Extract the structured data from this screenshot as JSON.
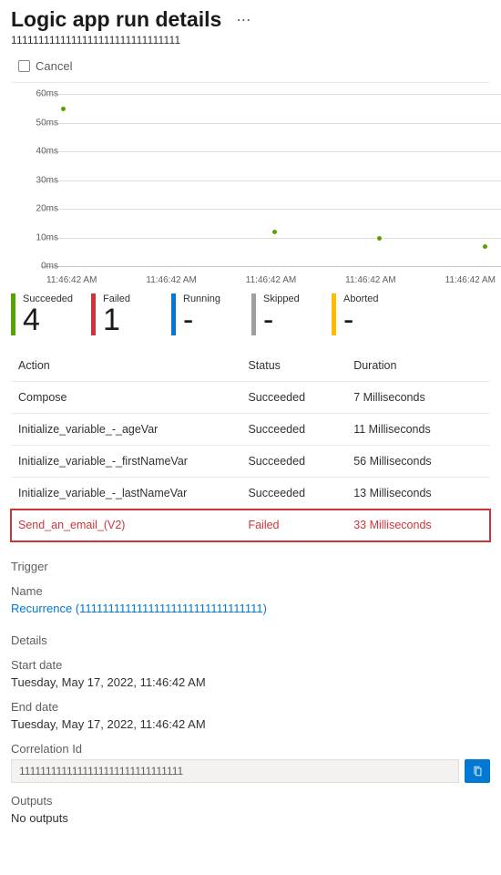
{
  "header": {
    "title": "Logic app run details",
    "run_id": "1111111111111111111111111111111",
    "cancel_label": "Cancel"
  },
  "chart_data": {
    "type": "scatter",
    "ylabel": "",
    "ylim": [
      0,
      60
    ],
    "y_ticks": [
      "60ms",
      "50ms",
      "40ms",
      "30ms",
      "20ms",
      "10ms",
      "0ms"
    ],
    "x_ticks": [
      "11:46:42 AM",
      "11:46:42 AM",
      "11:46:42 AM",
      "11:46:42 AM",
      "11:46:42 AM"
    ],
    "series": [
      {
        "name": "durations",
        "color": "#57a300",
        "points": [
          {
            "x": 0,
            "y": 55
          },
          {
            "x": 2,
            "y": 12
          },
          {
            "x": 3,
            "y": 10
          },
          {
            "x": 4,
            "y": 7
          }
        ]
      }
    ]
  },
  "kpis": {
    "succeeded": {
      "label": "Succeeded",
      "value": "4"
    },
    "failed": {
      "label": "Failed",
      "value": "1"
    },
    "running": {
      "label": "Running",
      "value": "-"
    },
    "skipped": {
      "label": "Skipped",
      "value": "-"
    },
    "aborted": {
      "label": "Aborted",
      "value": "-"
    }
  },
  "table": {
    "columns": {
      "action": "Action",
      "status": "Status",
      "duration": "Duration"
    },
    "rows": [
      {
        "action": "Compose",
        "status": "Succeeded",
        "duration": "7 Milliseconds"
      },
      {
        "action": "Initialize_variable_-_ageVar",
        "status": "Succeeded",
        "duration": "11 Milliseconds"
      },
      {
        "action": "Initialize_variable_-_firstNameVar",
        "status": "Succeeded",
        "duration": "56 Milliseconds"
      },
      {
        "action": "Initialize_variable_-_lastNameVar",
        "status": "Succeeded",
        "duration": "13 Milliseconds"
      },
      {
        "action": "Send_an_email_(V2)",
        "status": "Failed",
        "duration": "33 Milliseconds"
      }
    ]
  },
  "trigger": {
    "heading": "Trigger",
    "name_label": "Name",
    "link_text": "Recurrence  (11111111111111111111111111111111)"
  },
  "details": {
    "heading": "Details",
    "start_label": "Start date",
    "start_value": "Tuesday, May 17, 2022, 11:46:42 AM",
    "end_label": "End date",
    "end_value": "Tuesday, May 17, 2022, 11:46:42 AM",
    "corr_label": "Correlation Id",
    "corr_value": "1111111111111111111111111111111",
    "outputs_label": "Outputs",
    "outputs_value": "No outputs"
  }
}
